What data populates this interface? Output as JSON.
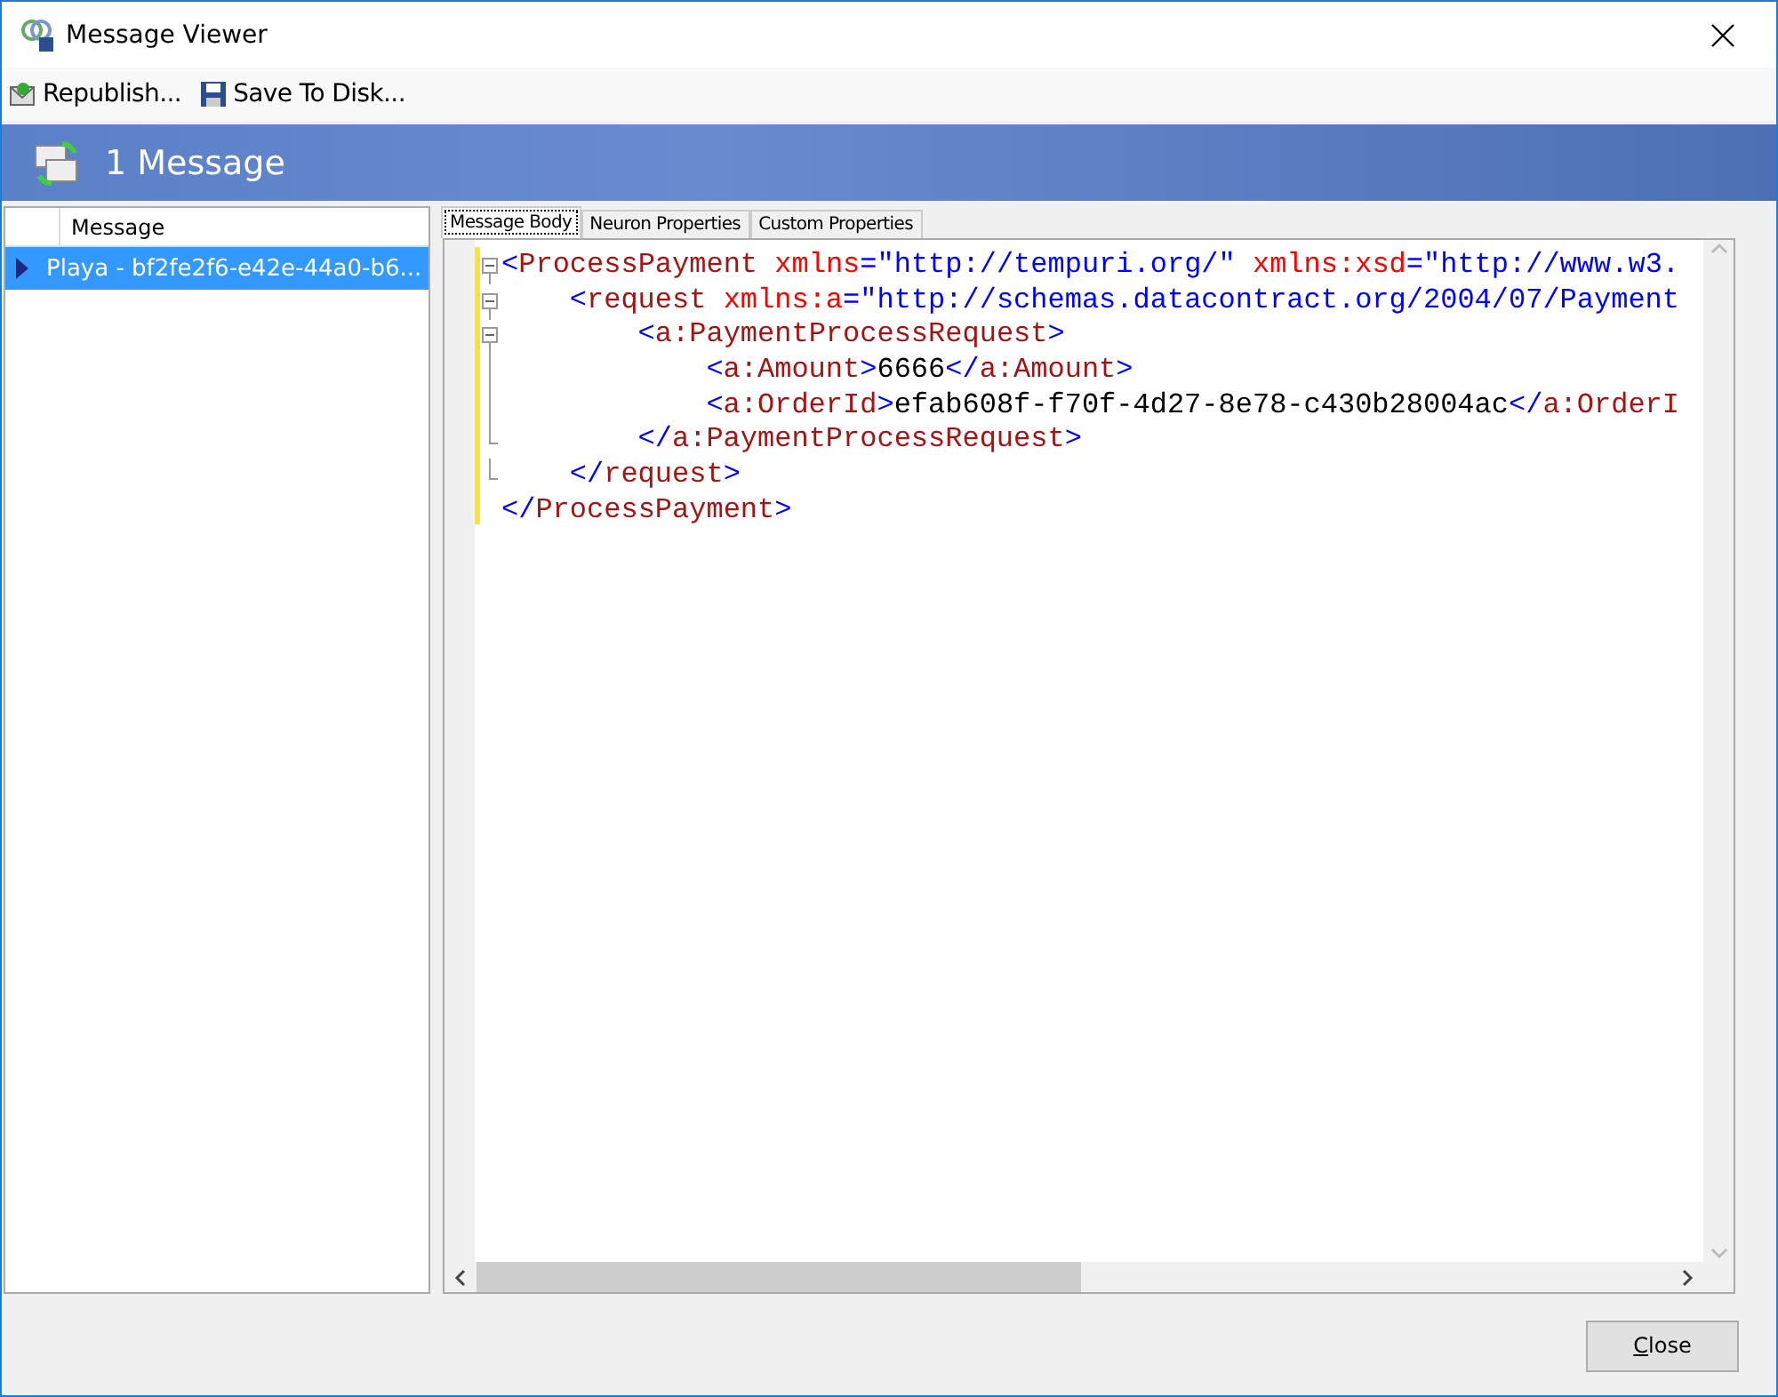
{
  "window": {
    "title": "Message Viewer"
  },
  "toolbar": [
    {
      "kind": "republish",
      "label": "Republish..."
    },
    {
      "kind": "save",
      "label": "Save To Disk..."
    }
  ],
  "header": {
    "title": "1 Message"
  },
  "message_list": {
    "columns": [
      "Message"
    ],
    "rows": [
      {
        "text": "Playa - bf2fe2f6-e42e-44a0-b6...",
        "selected": true
      }
    ]
  },
  "tabs": [
    {
      "label": "Message Body",
      "selected": true
    },
    {
      "label": "Neuron Properties",
      "selected": false
    },
    {
      "label": "Custom Properties",
      "selected": false
    }
  ],
  "xml_tree": [
    {
      "open": [
        {
          "kind": "bracket",
          "text": "<"
        },
        {
          "kind": "tag",
          "text": "ProcessPayment"
        },
        {
          "kind": "attr",
          "text": " xmlns"
        },
        {
          "kind": "bracket",
          "text": "=\"http://tempuri.org/\""
        },
        {
          "kind": "attr",
          "text": " xmlns:xsd"
        },
        {
          "kind": "bracket",
          "text": "=\"http://www.w3."
        }
      ],
      "close": [
        {
          "kind": "bracket",
          "text": "</"
        },
        {
          "kind": "tag",
          "text": "ProcessPayment"
        },
        {
          "kind": "bracket",
          "text": ">"
        }
      ],
      "children": [
        {
          "open": [
            {
              "kind": "bracket",
              "text": "<"
            },
            {
              "kind": "tag",
              "text": "request"
            },
            {
              "kind": "attr",
              "text": " xmlns:a"
            },
            {
              "kind": "bracket",
              "text": "=\"http://schemas.datacontract.org/2004/07/Payment"
            }
          ],
          "close": [
            {
              "kind": "bracket",
              "text": "</"
            },
            {
              "kind": "tag",
              "text": "request"
            },
            {
              "kind": "bracket",
              "text": ">"
            }
          ],
          "children": [
            {
              "open": [
                {
                  "kind": "bracket",
                  "text": "<"
                },
                {
                  "kind": "tag",
                  "text": "a:PaymentProcessRequest"
                },
                {
                  "kind": "bracket",
                  "text": ">"
                }
              ],
              "close": [
                {
                  "kind": "bracket",
                  "text": "</"
                },
                {
                  "kind": "tag",
                  "text": "a:PaymentProcessRequest"
                },
                {
                  "kind": "bracket",
                  "text": ">"
                }
              ],
              "children": [
                {
                  "open": [
                    {
                      "kind": "bracket",
                      "text": "<"
                    },
                    {
                      "kind": "tag",
                      "text": "a:Amount"
                    },
                    {
                      "kind": "bracket",
                      "text": ">"
                    },
                    {
                      "kind": "plain",
                      "text": "6666"
                    },
                    {
                      "kind": "bracket",
                      "text": "</"
                    },
                    {
                      "kind": "tag",
                      "text": "a:Amount"
                    },
                    {
                      "kind": "bracket",
                      "text": ">"
                    }
                  ]
                },
                {
                  "open": [
                    {
                      "kind": "bracket",
                      "text": "<"
                    },
                    {
                      "kind": "tag",
                      "text": "a:OrderId"
                    },
                    {
                      "kind": "bracket",
                      "text": ">"
                    },
                    {
                      "kind": "plain",
                      "text": "efab608f-f70f-4d27-8e78-c430b28004ac"
                    },
                    {
                      "kind": "bracket",
                      "text": "</"
                    },
                    {
                      "kind": "tag",
                      "text": "a:OrderI"
                    }
                  ]
                }
              ]
            }
          ]
        }
      ]
    }
  ],
  "buttons": [
    {
      "label": "Close"
    }
  ]
}
